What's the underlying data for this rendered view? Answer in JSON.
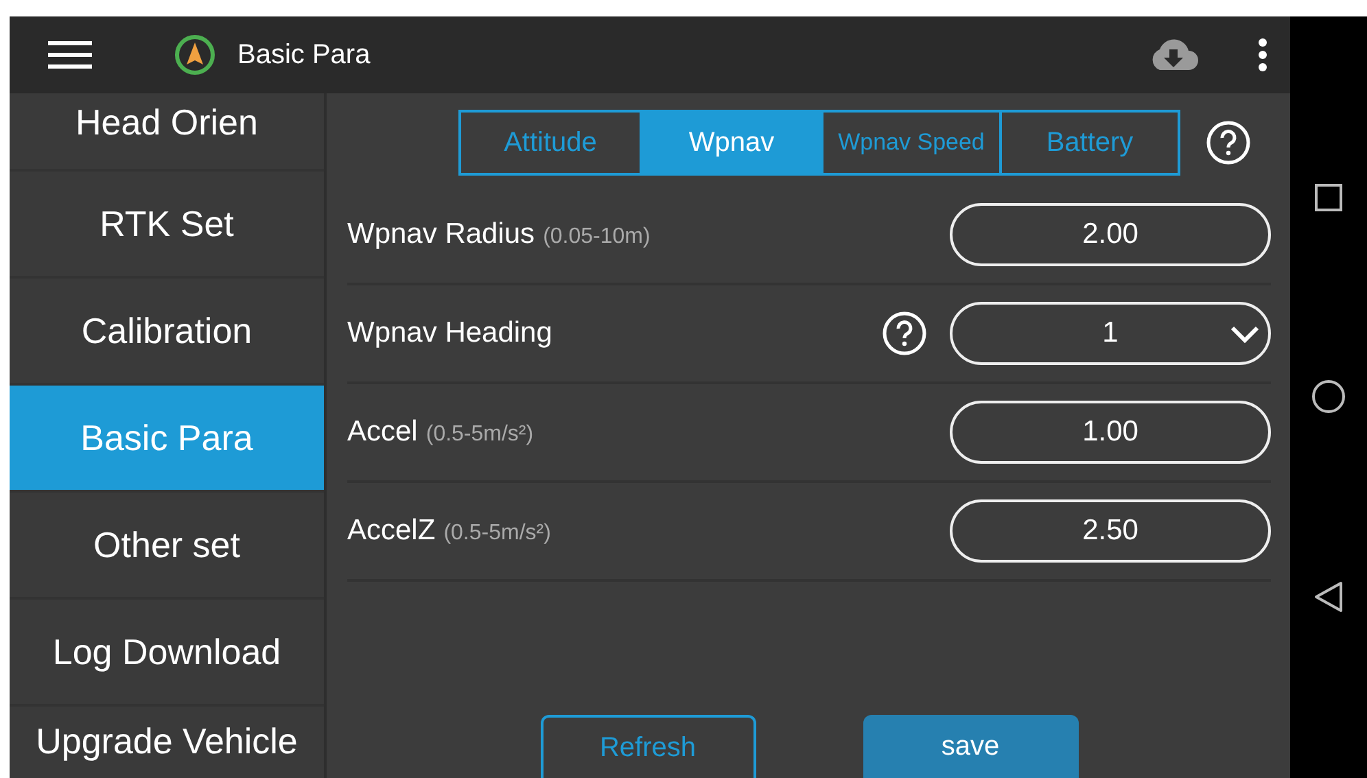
{
  "app_bar": {
    "title": "Basic Para"
  },
  "sidebar": {
    "items": [
      {
        "label": "Head Orien",
        "selected": false
      },
      {
        "label": "RTK Set",
        "selected": false
      },
      {
        "label": "Calibration",
        "selected": false
      },
      {
        "label": "Basic Para",
        "selected": true
      },
      {
        "label": "Other set",
        "selected": false
      },
      {
        "label": "Log Download",
        "selected": false
      },
      {
        "label": "Upgrade Vehicle",
        "selected": false
      }
    ]
  },
  "tabs": [
    {
      "label": "Attitude",
      "selected": false
    },
    {
      "label": "Wpnav",
      "selected": true
    },
    {
      "label": "Wpnav Speed",
      "selected": false
    },
    {
      "label": "Battery",
      "selected": false
    }
  ],
  "params": [
    {
      "kind": "input",
      "label": "Wpnav Radius",
      "range": "(0.05-10m)",
      "value": "2.00",
      "help": false
    },
    {
      "kind": "select",
      "label": "Wpnav Heading",
      "value": "1",
      "help": true
    },
    {
      "kind": "input",
      "label": "Accel",
      "range": "(0.5-5m/s²)",
      "value": "1.00",
      "help": false
    },
    {
      "kind": "input",
      "label": "AccelZ",
      "range": "(0.5-5m/s²)",
      "value": "2.50",
      "help": false
    }
  ],
  "buttons": [
    {
      "kind": "outline",
      "label": "Refresh"
    },
    {
      "kind": "filled",
      "label": "save"
    }
  ]
}
